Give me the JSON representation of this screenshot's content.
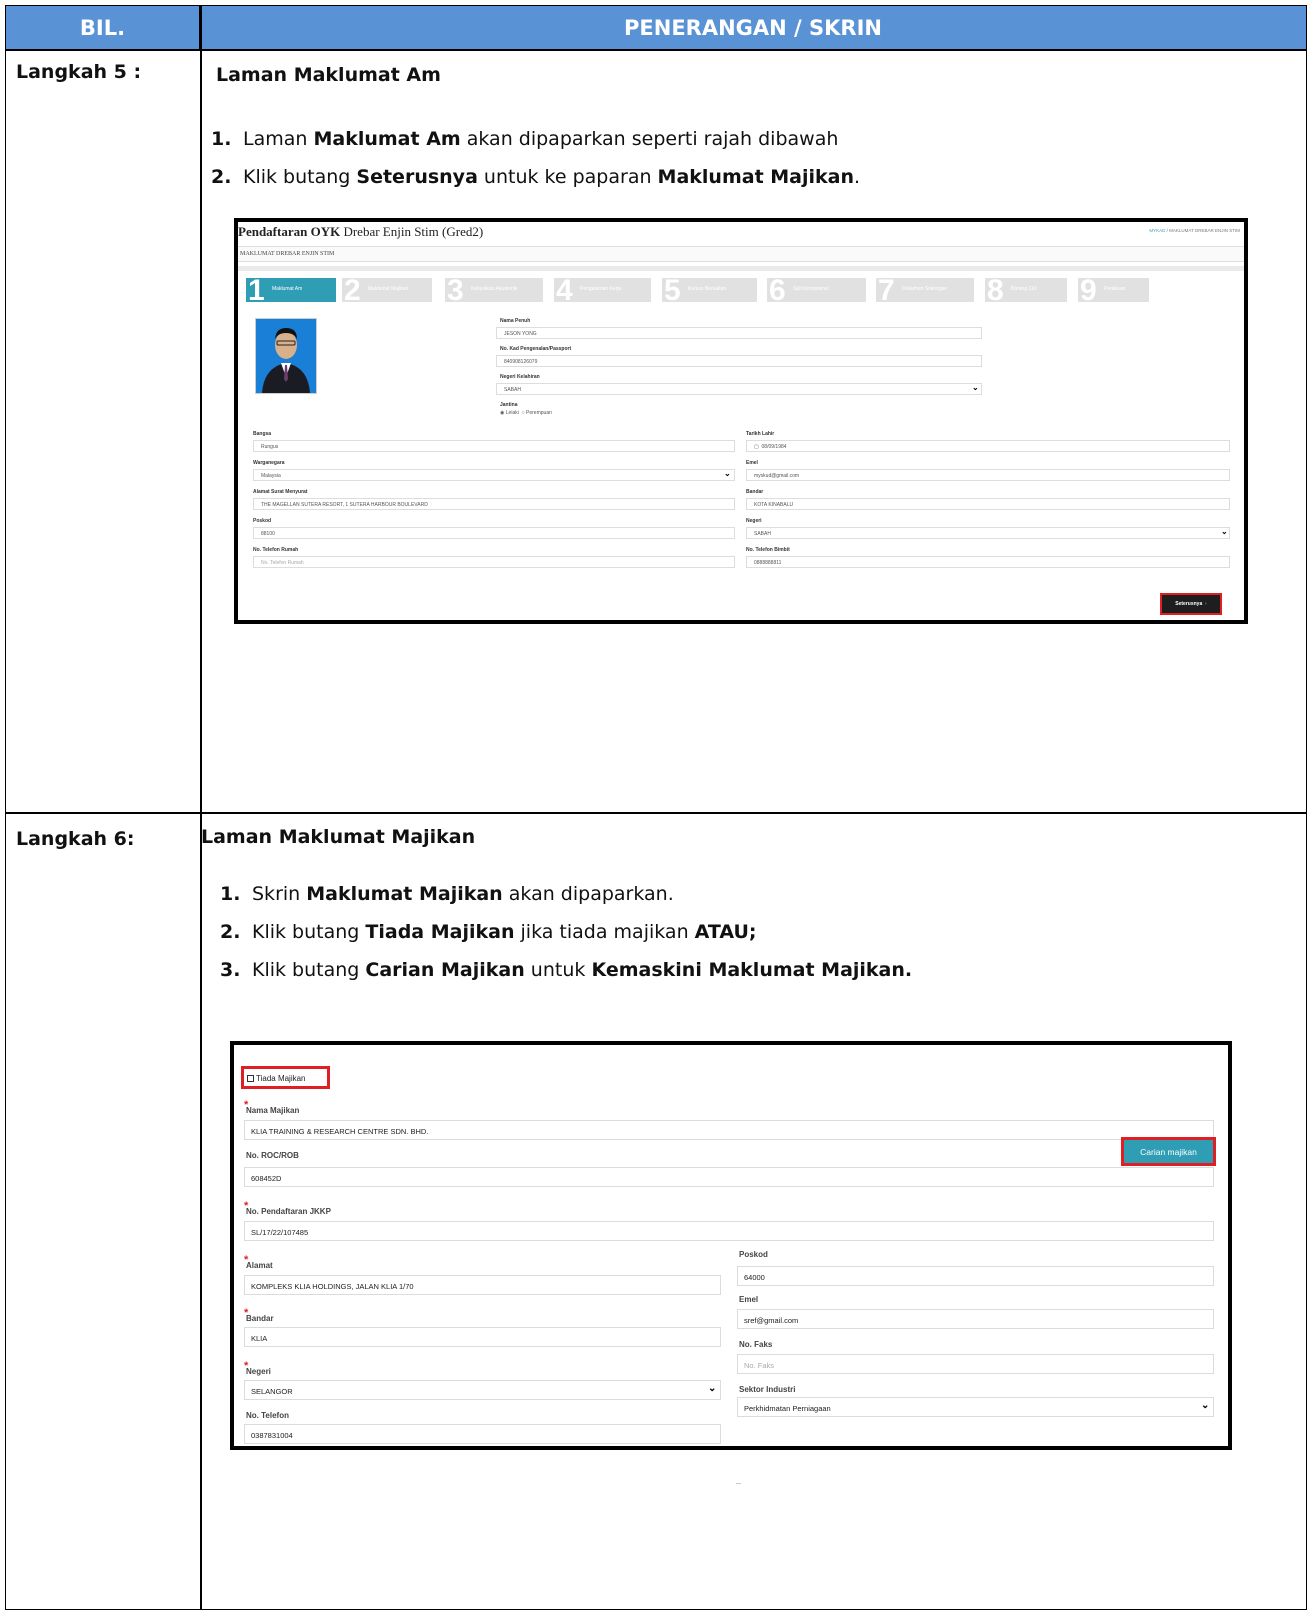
{
  "header": {
    "col1": "BIL.",
    "col2": "PENERANGAN / SKRIN"
  },
  "step5": {
    "label": "Langkah 5 :",
    "title": "Laman Maklumat Am",
    "instructions": [
      {
        "num": "1.",
        "pre": "Laman ",
        "b1": "Maklumat Am",
        "mid": " akan dipaparkan seperti rajah dibawah",
        "b2": "",
        "post": ""
      },
      {
        "num": "2.",
        "pre": "Klik butang ",
        "b1": "Seterusnya",
        "mid": " untuk ke paparan ",
        "b2": "Maklumat Majikan",
        "post": "."
      }
    ],
    "screen": {
      "app_title_bold": "Pendaftaran OYK",
      "app_title_rest": " Drebar Enjin Stim (Gred2)",
      "breadcrumb_link": "MYKAD",
      "breadcrumb_sep": " / ",
      "breadcrumb_current": "MAKLUMAT DREBAR ENJIN STIM",
      "subtitle": "MAKLUMAT DREBAR ENJIN STIM",
      "tabs": [
        {
          "num": "1",
          "label": "Maklumat Am"
        },
        {
          "num": "2",
          "label": "Maklumat Majikan"
        },
        {
          "num": "3",
          "label": "Kelayakan Akademik"
        },
        {
          "num": "4",
          "label": "Pengalaman Kerja"
        },
        {
          "num": "5",
          "label": "Kursus Berkaitan"
        },
        {
          "num": "6",
          "label": "Sijil Kompetensi"
        },
        {
          "num": "7",
          "label": "Dokumen Sokongan"
        },
        {
          "num": "8",
          "label": "Borang 110"
        },
        {
          "num": "9",
          "label": "Perakuan"
        }
      ],
      "fields": {
        "nama_penuh_label": "Nama Penuh",
        "nama_penuh": "JESON YONG",
        "kad_label": "No. Kad Pengenalan/Passport",
        "kad": "840908126079",
        "negeri_kelahiran_label": "Negeri Kelahiran",
        "negeri_kelahiran": "SABAH",
        "jantina_label": "Jantina",
        "jantina_lelaki": "Lelaki",
        "jantina_perempuan": "Perempuan",
        "bangsa_label": "Bangsa",
        "bangsa": "Rungus",
        "tarikh_lahir_label": "Tarikh Lahir",
        "tarikh_lahir": "08/09/1984",
        "warganegara_label": "Warganegara",
        "warganegara": "Malaysia",
        "emel_label": "Emel",
        "emel": "myskud@gmail.com",
        "alamat_label": "Alamat Surat Menyurat",
        "alamat": "THE MAGELLAN SUTERA RESORT, 1 SUTERA HARBOUR BOULEVARD",
        "bandar_label": "Bandar",
        "bandar": "KOTA KINABALU",
        "poskod_label": "Poskod",
        "poskod": "88100",
        "negeri_label": "Negeri",
        "negeri": "SABAH",
        "tel_rumah_label": "No. Telefon Rumah",
        "tel_rumah_placeholder": "No. Telefon Rumah",
        "tel_bimbit_label": "No. Telefon Bimbit",
        "tel_bimbit": "0888888811"
      },
      "next_button": "Seterusnya"
    }
  },
  "step6": {
    "label": "Langkah 6:",
    "title": "Laman Maklumat Majikan",
    "instructions": [
      {
        "num": "1.",
        "pre": "Skrin ",
        "b1": "Maklumat Majikan",
        "mid": " akan dipaparkan.",
        "b2": "",
        "post": ""
      },
      {
        "num": "2.",
        "pre": "Klik butang ",
        "b1": "Tiada Majikan",
        "mid": " jika tiada majikan ",
        "b2": "ATAU;",
        "post": ""
      },
      {
        "num": "3.",
        "pre": "Klik butang ",
        "b1": "Carian Majikan",
        "mid": " untuk ",
        "b2": "Kemaskini Maklumat Majikan.",
        "post": ""
      }
    ],
    "screen": {
      "tiada_majikan": "Tiada Majikan",
      "nama_majikan_label": "Nama Majikan",
      "nama_majikan": "KLIA TRAINING & RESEARCH CENTRE SDN. BHD.",
      "roc_label": "No. ROC/ROB",
      "roc": "608452D",
      "carian_button": "Carian majikan",
      "jkkp_label": "No. Pendaftaran JKKP",
      "jkkp": "SL/17/22/107485",
      "alamat_label": "Alamat",
      "alamat": "KOMPLEKS KLIA HOLDINGS, JALAN KLIA 1/70",
      "poskod_label": "Poskod",
      "poskod": "64000",
      "emel_label": "Emel",
      "emel": "sref@gmail.com",
      "bandar_label": "Bandar",
      "bandar": "KLIA",
      "faks_label": "No. Faks",
      "faks_placeholder": "No. Faks",
      "negeri_label": "Negeri",
      "negeri": "SELANGOR",
      "sektor_label": "Sektor Industri",
      "sektor": "Perkhidmatan Perniagaan",
      "telefon_label": "No. Telefon",
      "telefon": "0387831004"
    }
  }
}
